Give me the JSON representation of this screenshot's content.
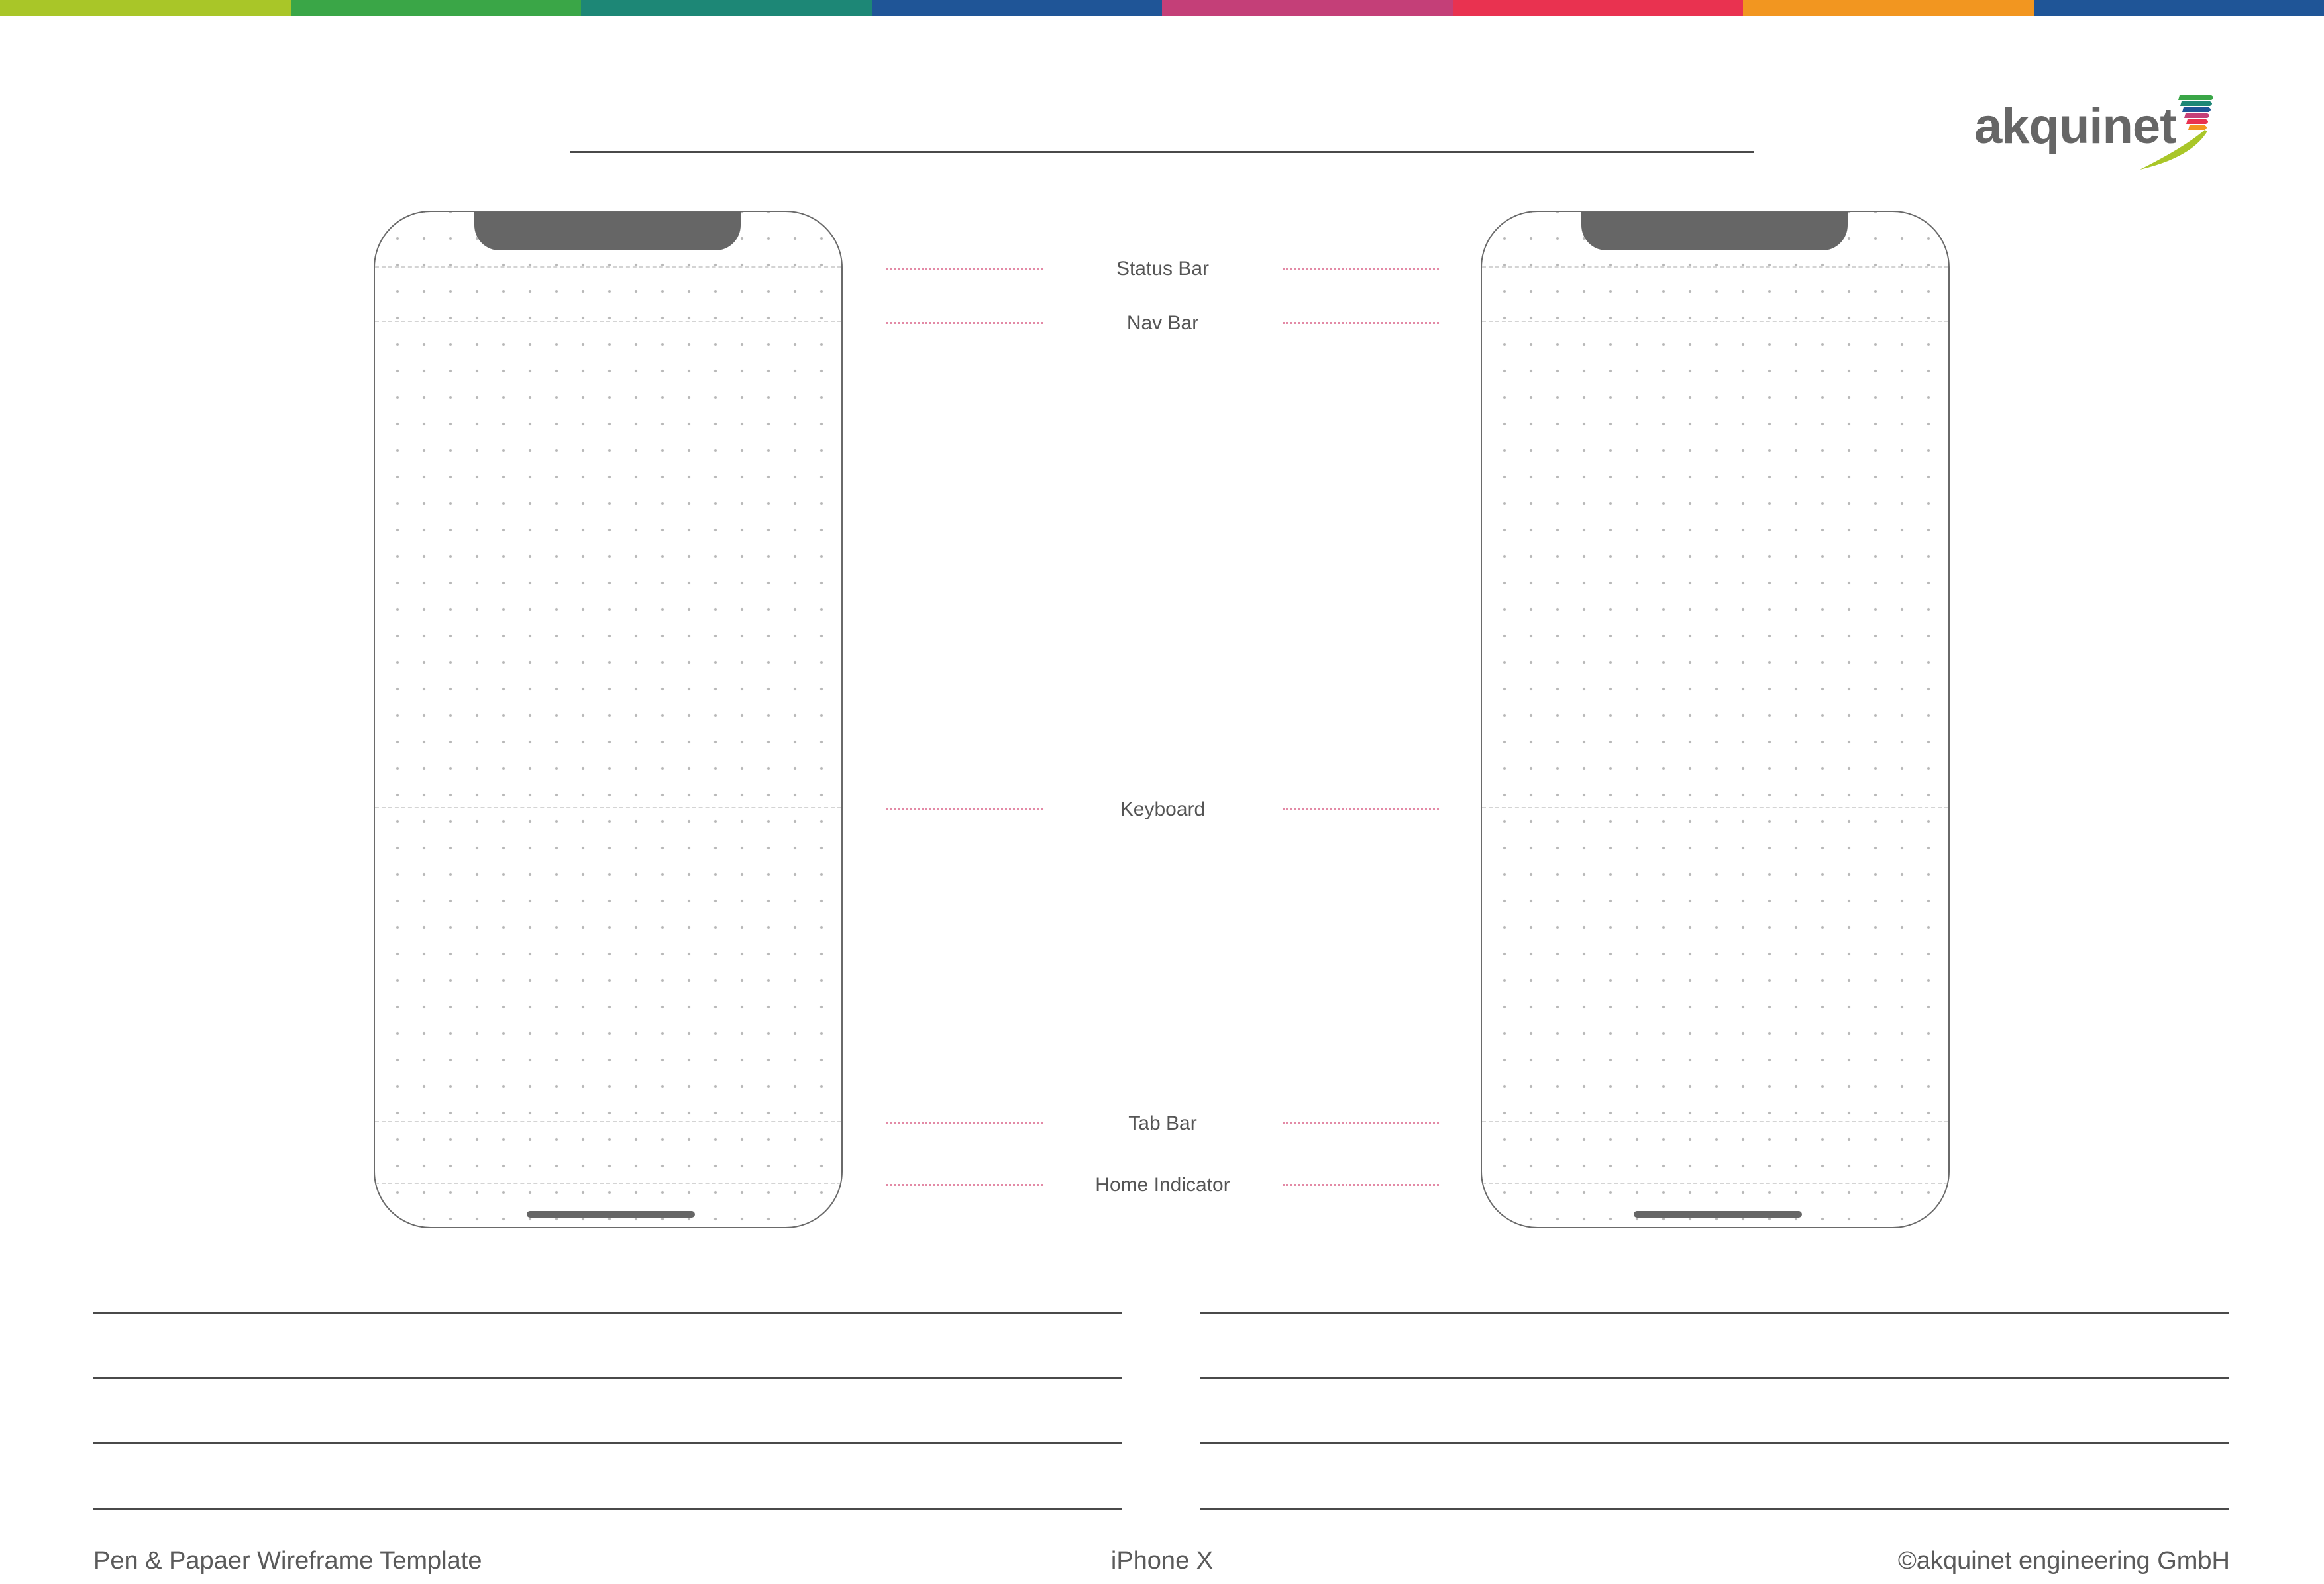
{
  "top_bar": {
    "colors": [
      "#a9c628",
      "#3aa647",
      "#1d8776",
      "#1f5597",
      "#c43f78",
      "#e93250",
      "#f29620",
      "#1f5597"
    ]
  },
  "logo": {
    "text": "akquinet",
    "stripe_colors": [
      "#3aa647",
      "#1d8776",
      "#1f5597",
      "#c43f78",
      "#e93250",
      "#f29620",
      "#a9c628"
    ]
  },
  "guides": {
    "labels": [
      "Status Bar",
      "Nav Bar",
      "Keyboard",
      "Tab Bar",
      "Home Indicator"
    ],
    "leader_color": "#e38aa6"
  },
  "phones": [
    "left",
    "right"
  ],
  "footer": {
    "left": "Pen & Papaer Wireframe Template",
    "center": "iPhone X",
    "right": "©akquinet engineering GmbH"
  }
}
